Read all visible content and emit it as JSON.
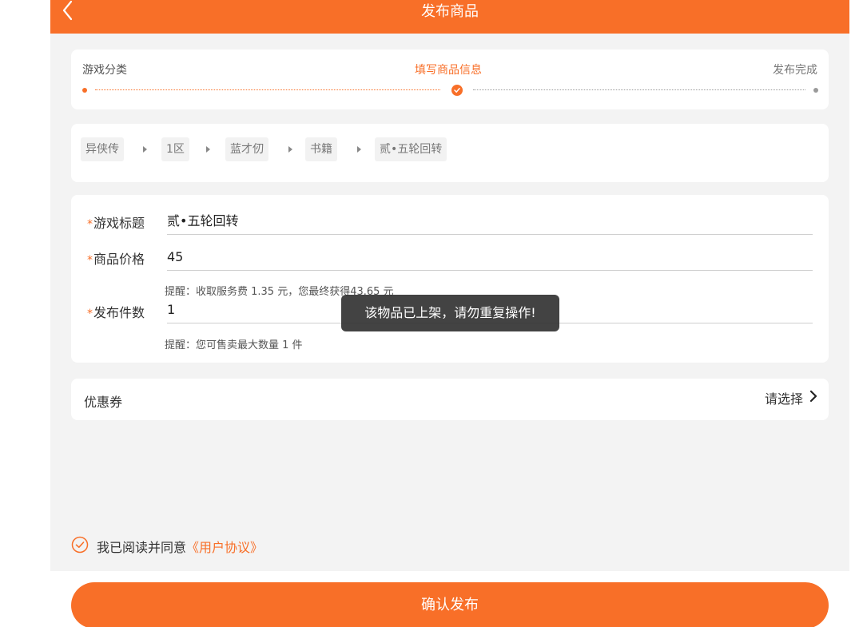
{
  "header": {
    "title": "发布商品",
    "back_icon": "chevron-left-icon"
  },
  "steps": [
    {
      "label": "游戏分类",
      "state": "done"
    },
    {
      "label": "填写商品信息",
      "state": "active"
    },
    {
      "label": "发布完成",
      "state": "pending"
    }
  ],
  "breadcrumb": [
    "异侠传",
    "1区",
    "蓝才仞",
    "书籍",
    "贰•五轮回转"
  ],
  "form": {
    "required_mark": "*",
    "title_label": "游戏标题",
    "title_value": "贰•五轮回转",
    "price_label": "商品价格",
    "price_value": "45",
    "price_hint": "提醒：收取服务费 1.35 元，您最终获得43.65 元",
    "count_label": "发布件数",
    "count_value": "1",
    "count_hint": "提醒：您可售卖最大数量 1 件"
  },
  "coupon": {
    "label": "优惠券",
    "select_text": "请选择"
  },
  "agreement": {
    "text": "我已阅读并同意",
    "link": "《用户协议》",
    "checked": true
  },
  "confirm_button": "确认发布",
  "toast": "该物品已上架，请勿重复操作!",
  "colors": {
    "accent": "#f86f28",
    "background": "#f3f3f3"
  }
}
